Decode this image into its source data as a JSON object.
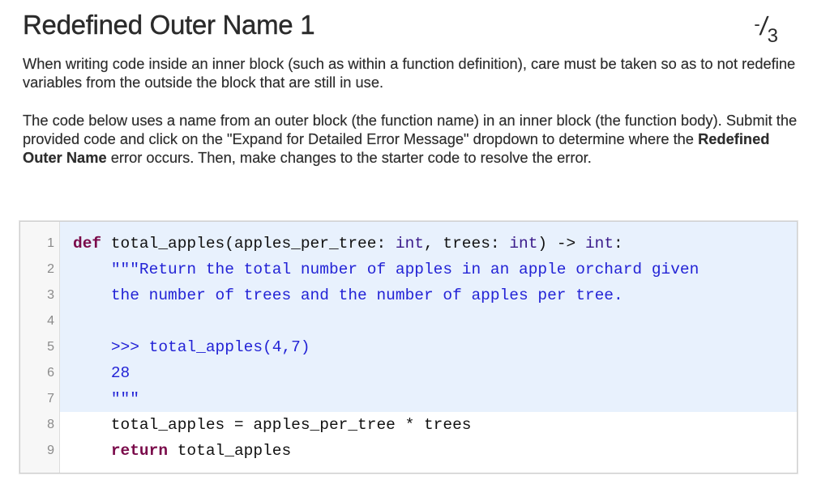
{
  "header": {
    "title": "Redefined Outer Name 1",
    "score": {
      "earned": "-",
      "total": "3"
    }
  },
  "description": {
    "paragraph1": "When writing code inside an inner block (such as within a function definition), care must be taken so as to not redefine variables from the outside the block that are still in use.",
    "paragraph2": {
      "before": "The code below uses a name from an outer block (the function name) in an inner block (the function body). Submit the provided code and click on the \"Expand for Detailed Error Message\" dropdown to determine where the ",
      "bold": "Redefined Outer Name",
      "after": " error occurs. Then, make changes to the starter code to resolve the error."
    }
  },
  "editor": {
    "highlight_color": "#e8f1fd",
    "lines": [
      {
        "number": "1",
        "highlighted": true,
        "tokens": [
          {
            "t": "def",
            "c": "kw"
          },
          {
            "t": " total_apples(apples_per_tree: ",
            "c": "op"
          },
          {
            "t": "int",
            "c": "bi"
          },
          {
            "t": ", trees: ",
            "c": "op"
          },
          {
            "t": "int",
            "c": "bi"
          },
          {
            "t": ") -> ",
            "c": "op"
          },
          {
            "t": "int",
            "c": "bi"
          },
          {
            "t": ":",
            "c": "op"
          }
        ]
      },
      {
        "number": "2",
        "highlighted": true,
        "tokens": [
          {
            "t": "    ",
            "c": "op"
          },
          {
            "t": "\"\"\"Return the total number of apples in an apple orchard given",
            "c": "str"
          }
        ]
      },
      {
        "number": "3",
        "highlighted": true,
        "tokens": [
          {
            "t": "    ",
            "c": "op"
          },
          {
            "t": "the number of trees and the number of apples per tree.",
            "c": "str"
          }
        ]
      },
      {
        "number": "4",
        "highlighted": true,
        "tokens": []
      },
      {
        "number": "5",
        "highlighted": true,
        "tokens": [
          {
            "t": "    ",
            "c": "op"
          },
          {
            "t": ">>> total_apples(4,7)",
            "c": "str"
          }
        ]
      },
      {
        "number": "6",
        "highlighted": true,
        "tokens": [
          {
            "t": "    ",
            "c": "op"
          },
          {
            "t": "28",
            "c": "str"
          }
        ]
      },
      {
        "number": "7",
        "highlighted": true,
        "tokens": [
          {
            "t": "    ",
            "c": "op"
          },
          {
            "t": "\"\"\"",
            "c": "str"
          }
        ]
      },
      {
        "number": "8",
        "highlighted": false,
        "tokens": [
          {
            "t": "    total_apples = apples_per_tree * trees",
            "c": "op"
          }
        ]
      },
      {
        "number": "9",
        "highlighted": false,
        "tokens": [
          {
            "t": "    ",
            "c": "op"
          },
          {
            "t": "return",
            "c": "kw"
          },
          {
            "t": " total_apples",
            "c": "op"
          }
        ]
      }
    ]
  }
}
